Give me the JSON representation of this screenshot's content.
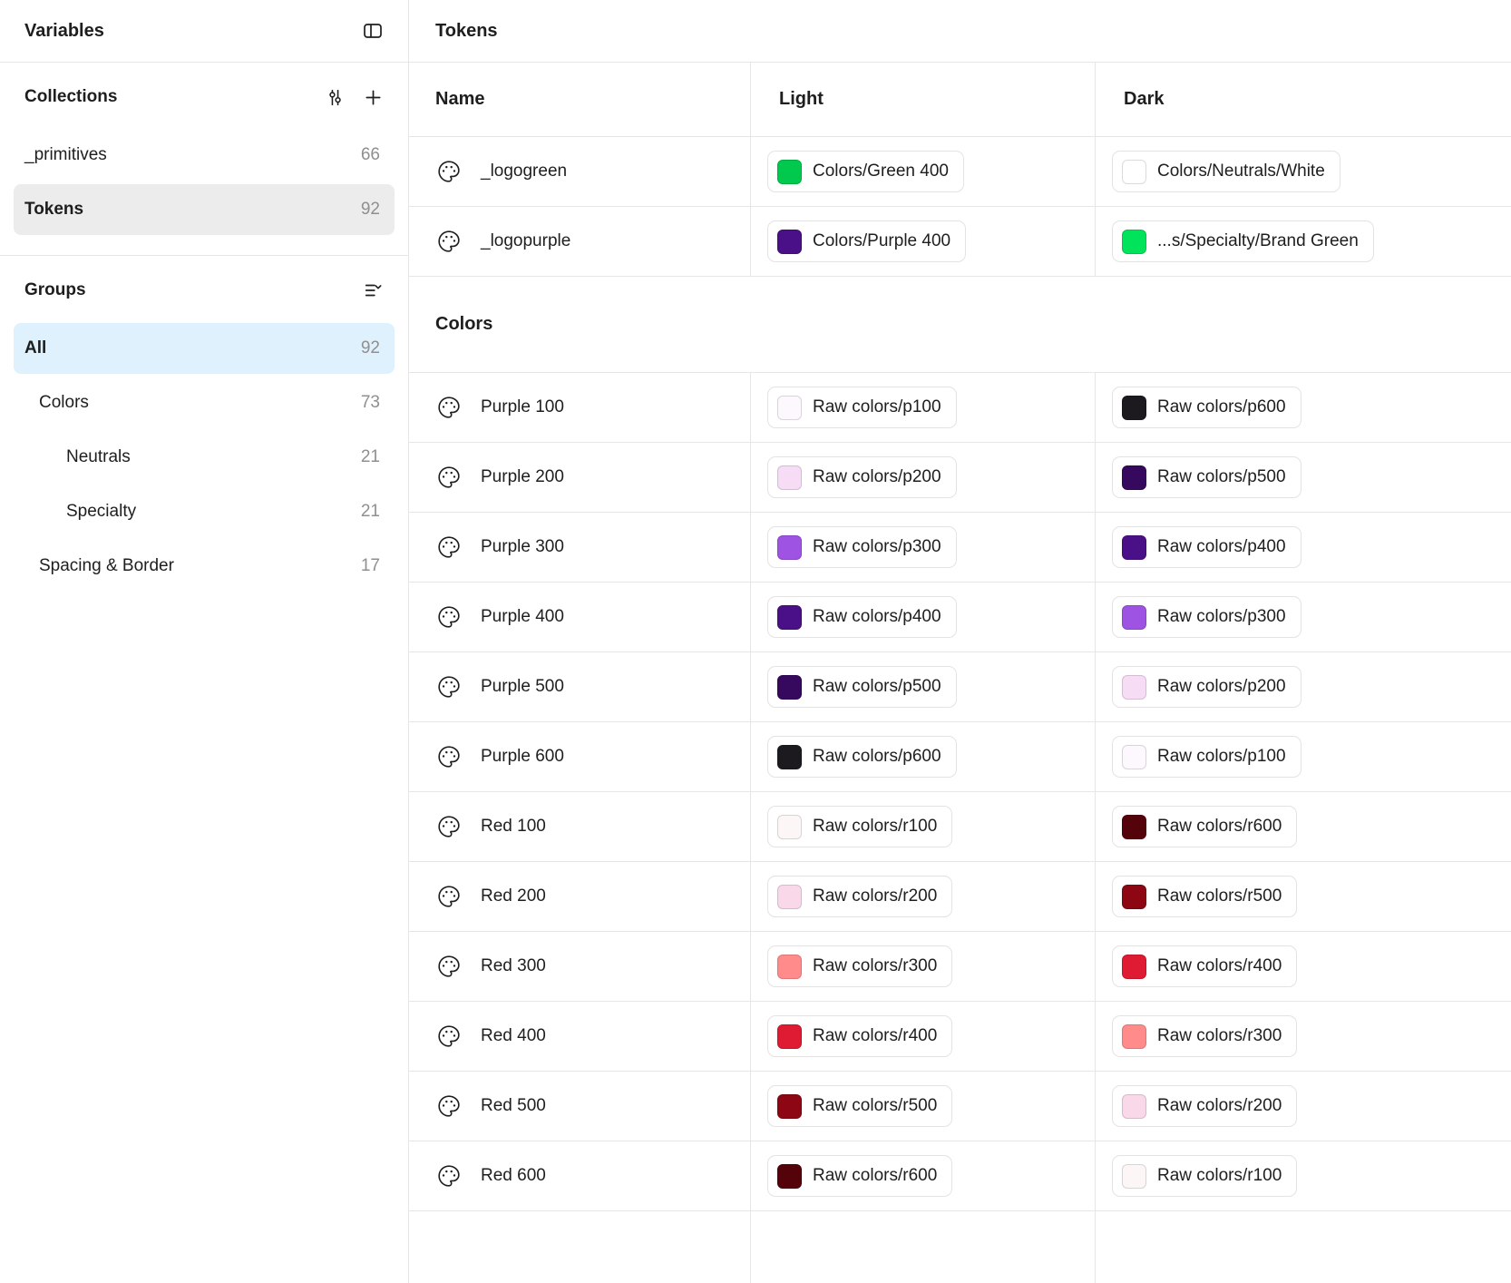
{
  "colors": {
    "selection_blue": "#def1fc",
    "selection_gray": "#ececec",
    "border": "#e6e6e6"
  },
  "sidebar": {
    "title": "Variables",
    "collections": {
      "label": "Collections",
      "items": [
        {
          "name": "_primitives",
          "count": "66",
          "selected": false
        },
        {
          "name": "Tokens",
          "count": "92",
          "selected": true
        }
      ]
    },
    "groups": {
      "label": "Groups",
      "items": [
        {
          "name": "All",
          "count": "92",
          "indent": 0,
          "selected": true
        },
        {
          "name": "Colors",
          "count": "73",
          "indent": 1,
          "selected": false
        },
        {
          "name": "Neutrals",
          "count": "21",
          "indent": 2,
          "selected": false
        },
        {
          "name": "Specialty",
          "count": "21",
          "indent": 2,
          "selected": false
        },
        {
          "name": "Spacing & Border",
          "count": "17",
          "indent": 1,
          "selected": false
        }
      ]
    }
  },
  "main": {
    "title": "Tokens",
    "columns": [
      "Name",
      "Light",
      "Dark"
    ],
    "token_rows": [
      {
        "name": "_logogreen",
        "light": {
          "color": "#00c94d",
          "label": "Colors/Green 400"
        },
        "dark": {
          "color": "#ffffff",
          "label": "Colors/Neutrals/White"
        }
      },
      {
        "name": "_logopurple",
        "light": {
          "color": "#4a1087",
          "label": "Colors/Purple 400"
        },
        "dark": {
          "color": "#00e35a",
          "label": "...s/Specialty/Brand Green"
        }
      }
    ],
    "section_label": "Colors",
    "color_rows": [
      {
        "name": "Purple 100",
        "light": {
          "color": "#fdf7fe",
          "label": "Raw colors/p100"
        },
        "dark": {
          "color": "#1d1a1f",
          "label": "Raw colors/p600"
        }
      },
      {
        "name": "Purple 200",
        "light": {
          "color": "#f7dcf5",
          "label": "Raw colors/p200"
        },
        "dark": {
          "color": "#36095e",
          "label": "Raw colors/p500"
        }
      },
      {
        "name": "Purple 300",
        "light": {
          "color": "#9e53e3",
          "label": "Raw colors/p300"
        },
        "dark": {
          "color": "#4a1087",
          "label": "Raw colors/p400"
        }
      },
      {
        "name": "Purple 400",
        "light": {
          "color": "#4a1087",
          "label": "Raw colors/p400"
        },
        "dark": {
          "color": "#9e53e3",
          "label": "Raw colors/p300"
        }
      },
      {
        "name": "Purple 500",
        "light": {
          "color": "#36095e",
          "label": "Raw colors/p500"
        },
        "dark": {
          "color": "#f7dcf5",
          "label": "Raw colors/p200"
        }
      },
      {
        "name": "Purple 600",
        "light": {
          "color": "#1d1a1f",
          "label": "Raw colors/p600"
        },
        "dark": {
          "color": "#fdf7fe",
          "label": "Raw colors/p100"
        }
      },
      {
        "name": "Red 100",
        "light": {
          "color": "#fdf6f7",
          "label": "Raw colors/r100"
        },
        "dark": {
          "color": "#55030b",
          "label": "Raw colors/r600"
        }
      },
      {
        "name": "Red 200",
        "light": {
          "color": "#f9d9e9",
          "label": "Raw colors/r200"
        },
        "dark": {
          "color": "#8c0613",
          "label": "Raw colors/r500"
        }
      },
      {
        "name": "Red 300",
        "light": {
          "color": "#ff8b8b",
          "label": "Raw colors/r300"
        },
        "dark": {
          "color": "#de1b32",
          "label": "Raw colors/r400"
        }
      },
      {
        "name": "Red 400",
        "light": {
          "color": "#de1b32",
          "label": "Raw colors/r400"
        },
        "dark": {
          "color": "#ff8b8b",
          "label": "Raw colors/r300"
        }
      },
      {
        "name": "Red 500",
        "light": {
          "color": "#8c0613",
          "label": "Raw colors/r500"
        },
        "dark": {
          "color": "#f9d9e9",
          "label": "Raw colors/r200"
        }
      },
      {
        "name": "Red 600",
        "light": {
          "color": "#55030b",
          "label": "Raw colors/r600"
        },
        "dark": {
          "color": "#fdf6f7",
          "label": "Raw colors/r100"
        }
      }
    ]
  }
}
